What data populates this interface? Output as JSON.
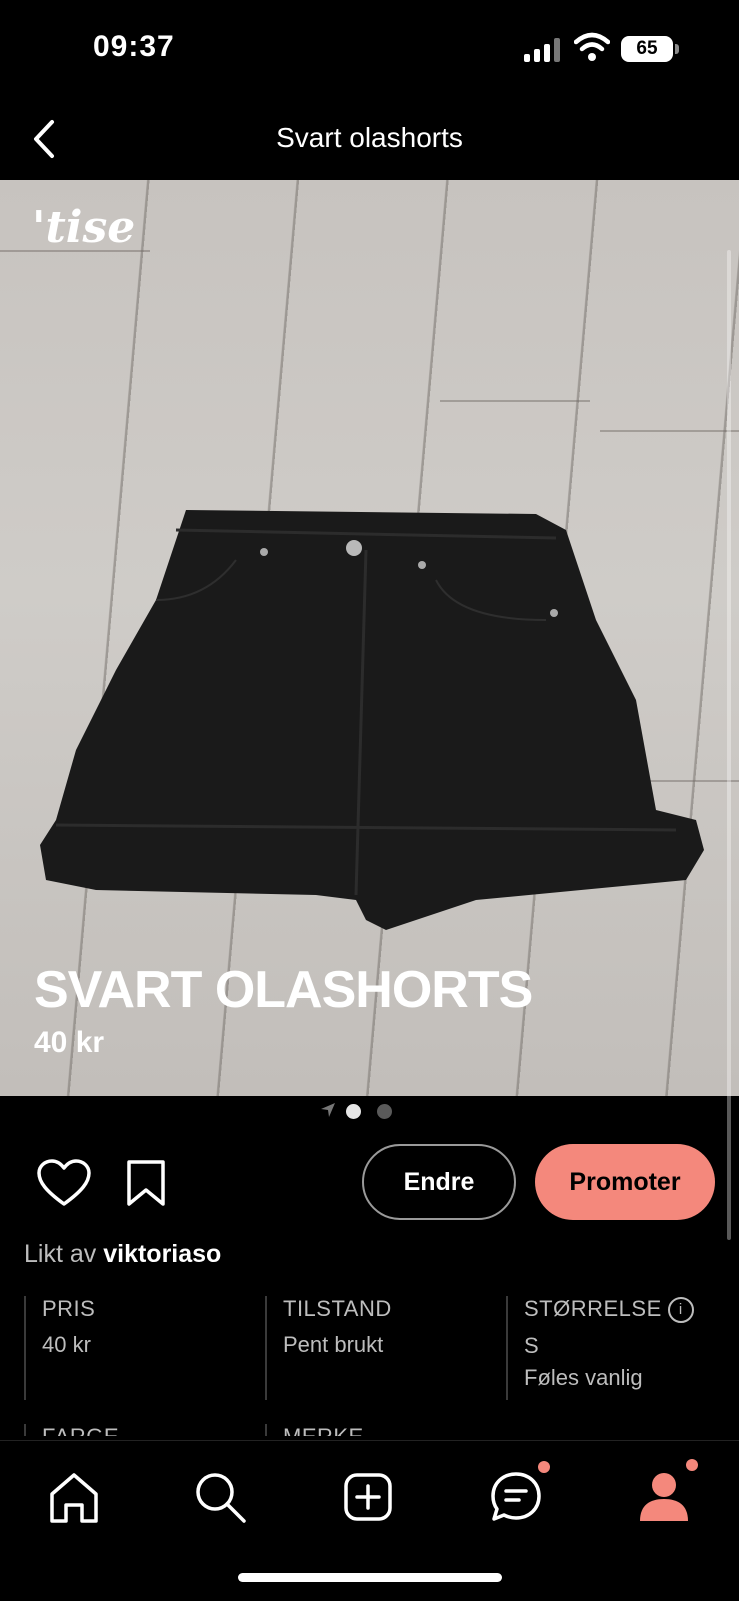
{
  "status_bar": {
    "time": "09:37",
    "battery": "65"
  },
  "nav": {
    "title": "Svart olashorts"
  },
  "hero": {
    "logo": "'tise",
    "title": "SVART OLASHORTS",
    "price": "40 kr"
  },
  "actions": {
    "edit_label": "Endre",
    "promote_label": "Promoter"
  },
  "likes": {
    "prefix": "Likt av",
    "user": "viktoriaso"
  },
  "attributes": [
    {
      "label": "PRIS",
      "value": "40 kr"
    },
    {
      "label": "TILSTAND",
      "value": "Pent brukt"
    },
    {
      "label": "STØRRELSE",
      "value": "S",
      "sub": "Føles vanlig"
    },
    {
      "label": "FARGE"
    },
    {
      "label": "MERKE"
    }
  ],
  "colors": {
    "accent": "#f4887c",
    "background": "#000000"
  }
}
